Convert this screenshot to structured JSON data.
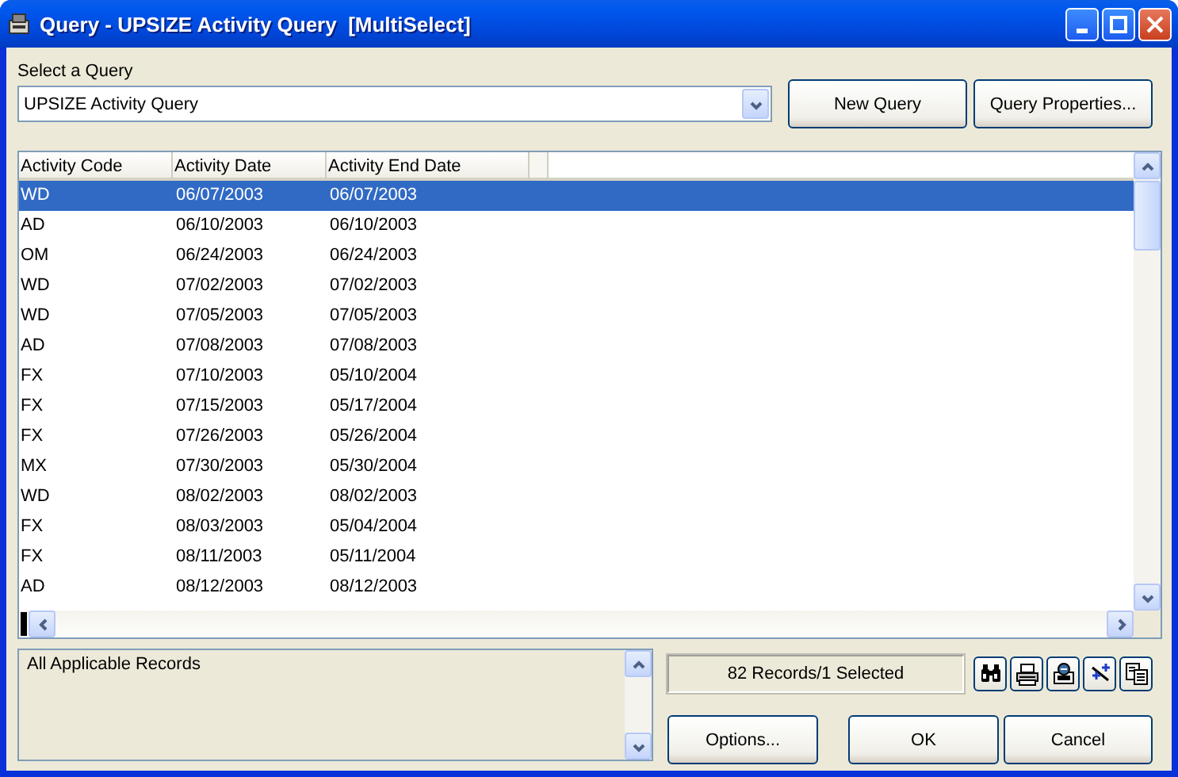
{
  "window": {
    "title": "Query - UPSIZE Activity Query  [MultiSelect]"
  },
  "query_select": {
    "label": "Select a Query",
    "value": "UPSIZE Activity Query"
  },
  "top_buttons": [
    "New Query",
    "Query Properties..."
  ],
  "table": {
    "columns": [
      "Activity Code",
      "Activity Date",
      "Activity End Date"
    ],
    "rows": [
      {
        "cells": [
          "WD",
          "06/07/2003",
          "06/07/2003"
        ],
        "selected": true
      },
      {
        "cells": [
          "AD",
          "06/10/2003",
          "06/10/2003"
        ],
        "selected": false
      },
      {
        "cells": [
          "OM",
          "06/24/2003",
          "06/24/2003"
        ],
        "selected": false
      },
      {
        "cells": [
          "WD",
          "07/02/2003",
          "07/02/2003"
        ],
        "selected": false
      },
      {
        "cells": [
          "WD",
          "07/05/2003",
          "07/05/2003"
        ],
        "selected": false
      },
      {
        "cells": [
          "AD",
          "07/08/2003",
          "07/08/2003"
        ],
        "selected": false
      },
      {
        "cells": [
          "FX",
          "07/10/2003",
          "05/10/2004"
        ],
        "selected": false
      },
      {
        "cells": [
          "FX",
          "07/15/2003",
          "05/17/2004"
        ],
        "selected": false
      },
      {
        "cells": [
          "FX",
          "07/26/2003",
          "05/26/2004"
        ],
        "selected": false
      },
      {
        "cells": [
          "MX",
          "07/30/2003",
          "05/30/2004"
        ],
        "selected": false
      },
      {
        "cells": [
          "WD",
          "08/02/2003",
          "08/02/2003"
        ],
        "selected": false
      },
      {
        "cells": [
          "FX",
          "08/03/2003",
          "05/04/2004"
        ],
        "selected": false
      },
      {
        "cells": [
          "FX",
          "08/11/2003",
          "05/11/2004"
        ],
        "selected": false
      },
      {
        "cells": [
          "AD",
          "08/12/2003",
          "08/12/2003"
        ],
        "selected": false
      }
    ]
  },
  "criteria": {
    "text": "All Applicable Records"
  },
  "status": "82 Records/1 Selected",
  "bottom_buttons": [
    "Options...",
    "OK",
    "Cancel"
  ]
}
